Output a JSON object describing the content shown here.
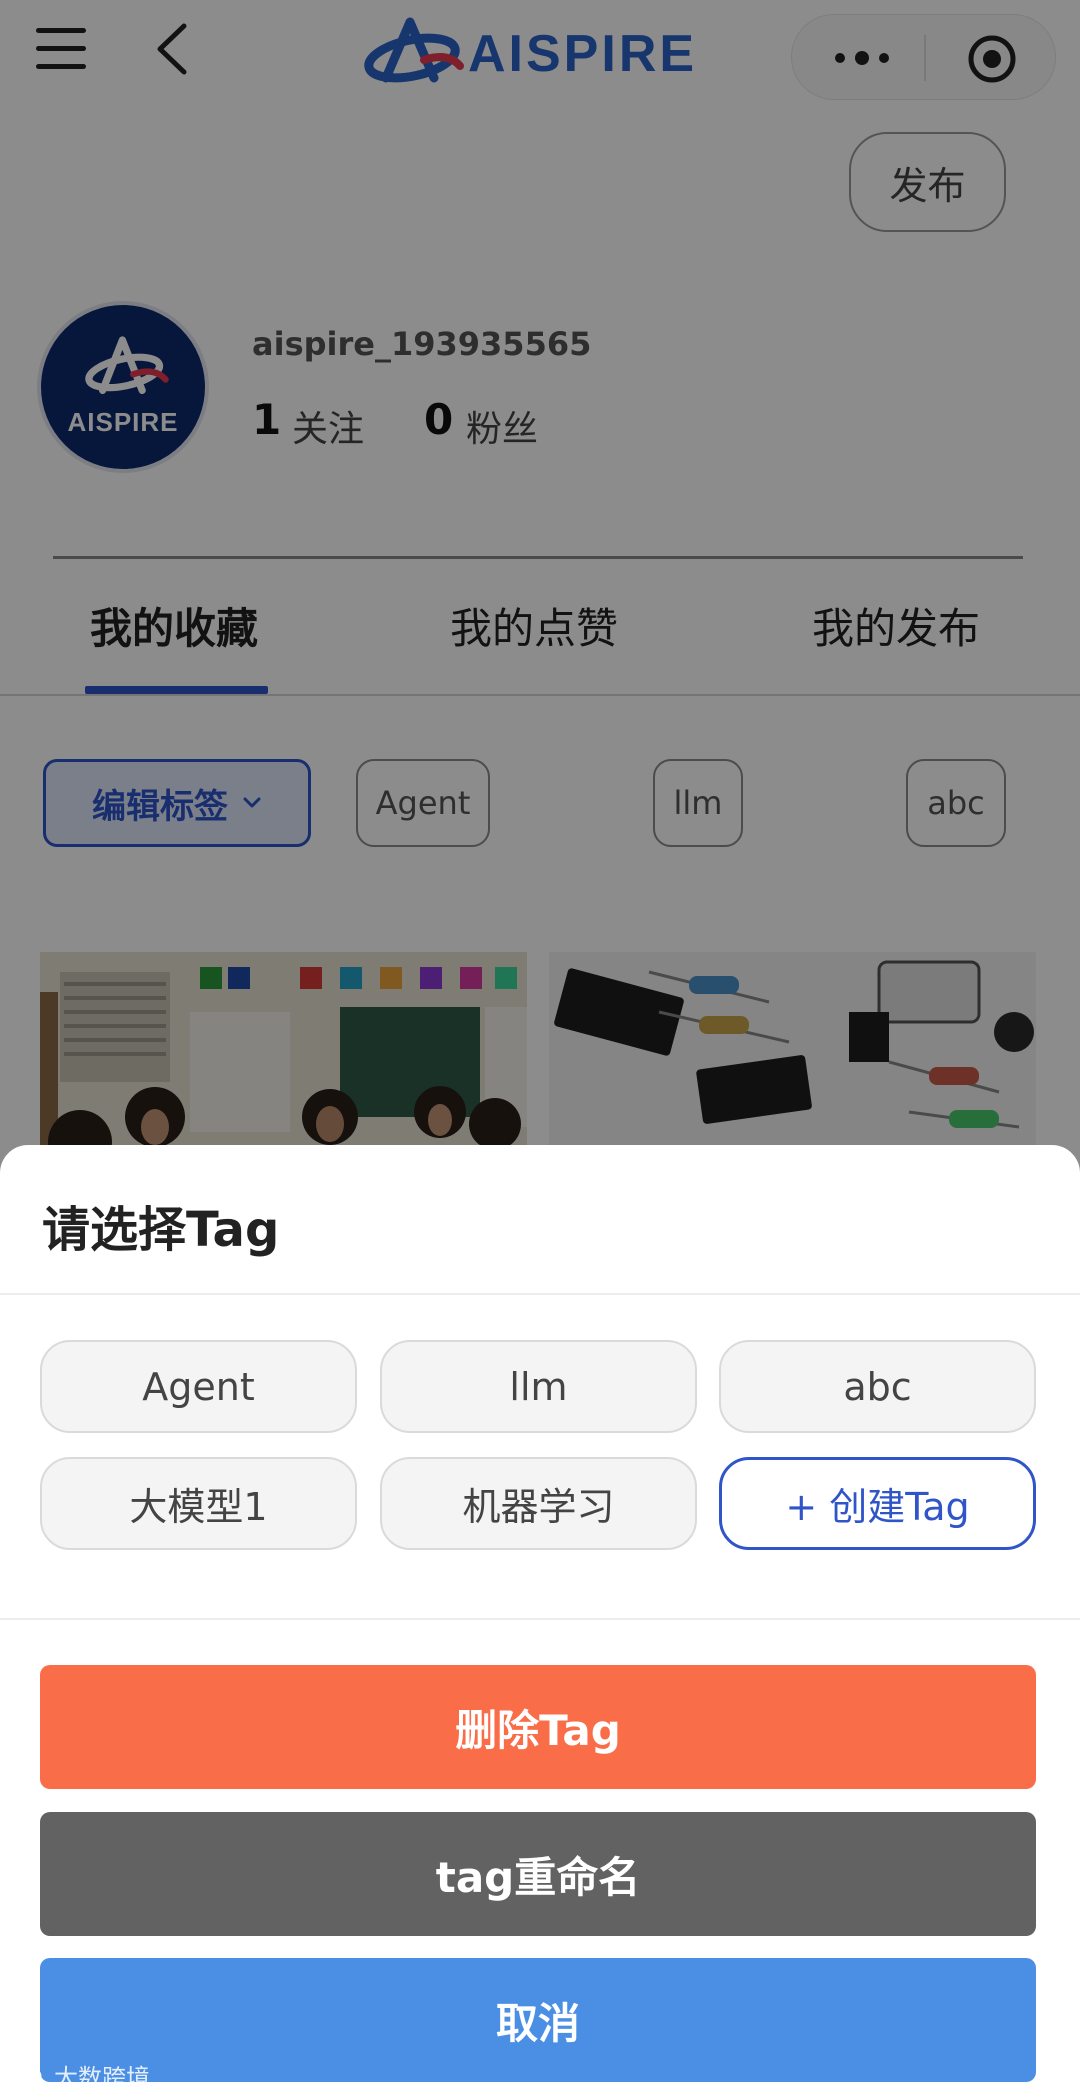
{
  "header": {
    "logo_text": "AISPIRE",
    "menu_icon": "hamburger-menu-icon",
    "back_icon": "chevron-left-icon",
    "more_icon": "more-dots-icon",
    "close_icon": "target-circle-icon"
  },
  "publish_button": "发布",
  "profile": {
    "avatar_text": "AISPIRE",
    "username": "aispire_193935565",
    "following_count": "1",
    "following_label": "关注",
    "followers_count": "0",
    "followers_label": "粉丝"
  },
  "tabs": [
    {
      "label": "我的收藏",
      "active": true
    },
    {
      "label": "我的点赞",
      "active": false
    },
    {
      "label": "我的发布",
      "active": false
    }
  ],
  "filter": {
    "edit_tags_label": "编辑标签",
    "chips": [
      "Agent",
      "llm",
      "abc"
    ]
  },
  "sheet": {
    "title": "请选择Tag",
    "tags": [
      "Agent",
      "llm",
      "abc",
      "大模型1",
      "机器学习"
    ],
    "create_tag_label": "+ 创建Tag",
    "delete_label": "删除Tag",
    "rename_label": "tag重命名",
    "cancel_label": "取消"
  },
  "watermark": "大数跨境",
  "colors": {
    "accent": "#2f55c9",
    "delete": "#f96d48",
    "rename": "#626262",
    "cancel": "#4a8fe4"
  }
}
